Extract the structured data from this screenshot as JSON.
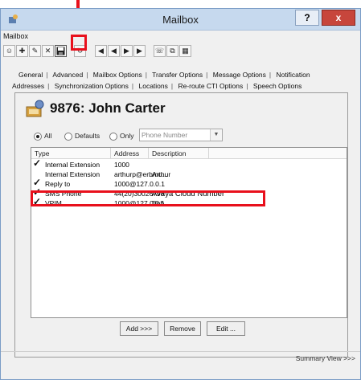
{
  "window": {
    "title": "Mailbox",
    "help_label": "?",
    "close_label": "x"
  },
  "menu": {
    "label": "Mailbox"
  },
  "tabs_row1": [
    "General",
    "Advanced",
    "Mailbox Options",
    "Transfer Options",
    "Message Options",
    "Notification"
  ],
  "tabs_row2": [
    "Addresses",
    "Synchronization Options",
    "Locations",
    "Re-route CTI Options",
    "Speech Options"
  ],
  "heading": "9876: John Carter",
  "filter": {
    "all": "All",
    "defaults": "Defaults",
    "only": "Only",
    "combo_value": "Phone Number",
    "selected": "All"
  },
  "columns": {
    "type": "Type",
    "address": "Address",
    "description": "Description"
  },
  "rows": [
    {
      "checked": true,
      "type": "Internal Extension",
      "address": "1000",
      "description": ""
    },
    {
      "checked": false,
      "type": "Internal Extension",
      "address": "arthurp@erbmu...",
      "description": "Arthur"
    },
    {
      "checked": true,
      "type": "Reply to",
      "address": "1000@127.0.0.1",
      "description": ""
    },
    {
      "checked": true,
      "type": "SMS Phone",
      "address": "44(20)30026798",
      "description": "Avaya Cloud Number"
    },
    {
      "checked": true,
      "type": "VPIM",
      "address": "1000@127.0.0.1",
      "description": "Bob"
    }
  ],
  "buttons": {
    "add": "Add >>>",
    "remove": "Remove",
    "edit": "Edit ..."
  },
  "summary": "Summary View >>>",
  "colors": {
    "highlight": "#e8101c",
    "titlebar": "#c6d9ee"
  }
}
